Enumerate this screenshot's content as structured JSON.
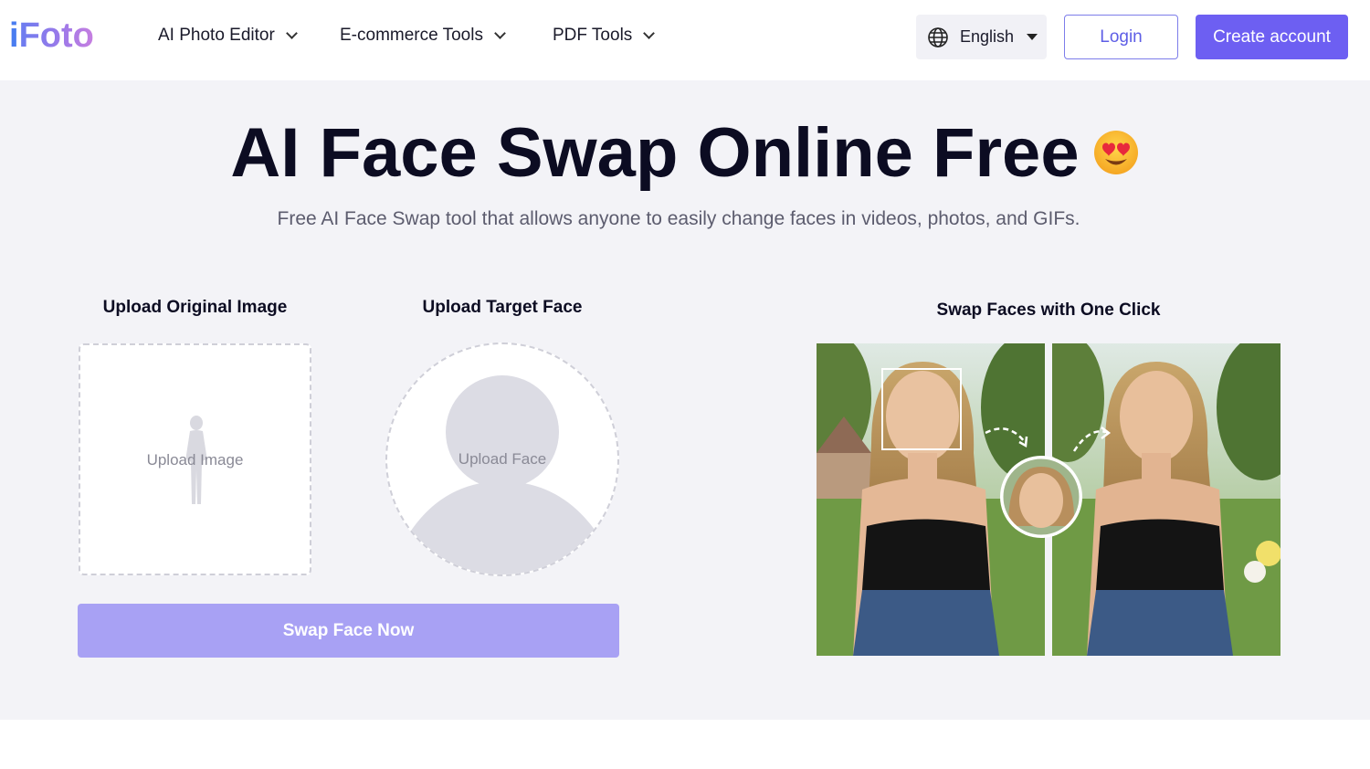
{
  "header": {
    "logo_i": "i",
    "logo_rest": "Foto",
    "nav": [
      {
        "label": "AI Photo Editor"
      },
      {
        "label": "E-commerce Tools"
      },
      {
        "label": "PDF Tools"
      }
    ],
    "language": "English",
    "login_label": "Login",
    "create_account_label": "Create account"
  },
  "hero": {
    "title": "AI Face Swap Online Free",
    "subtitle": "Free AI Face Swap tool that allows anyone to easily change faces in videos, photos, and GIFs."
  },
  "upload": {
    "original_label": "Upload Original Image",
    "original_placeholder": "Upload Image",
    "target_label": "Upload Target Face",
    "target_placeholder": "Upload Face",
    "swap_button": "Swap Face Now"
  },
  "demo": {
    "label": "Swap Faces with One Click"
  },
  "colors": {
    "primary": "#6d5ff2",
    "primary_disabled": "#a8a1f4",
    "background": "#f3f3f7"
  }
}
